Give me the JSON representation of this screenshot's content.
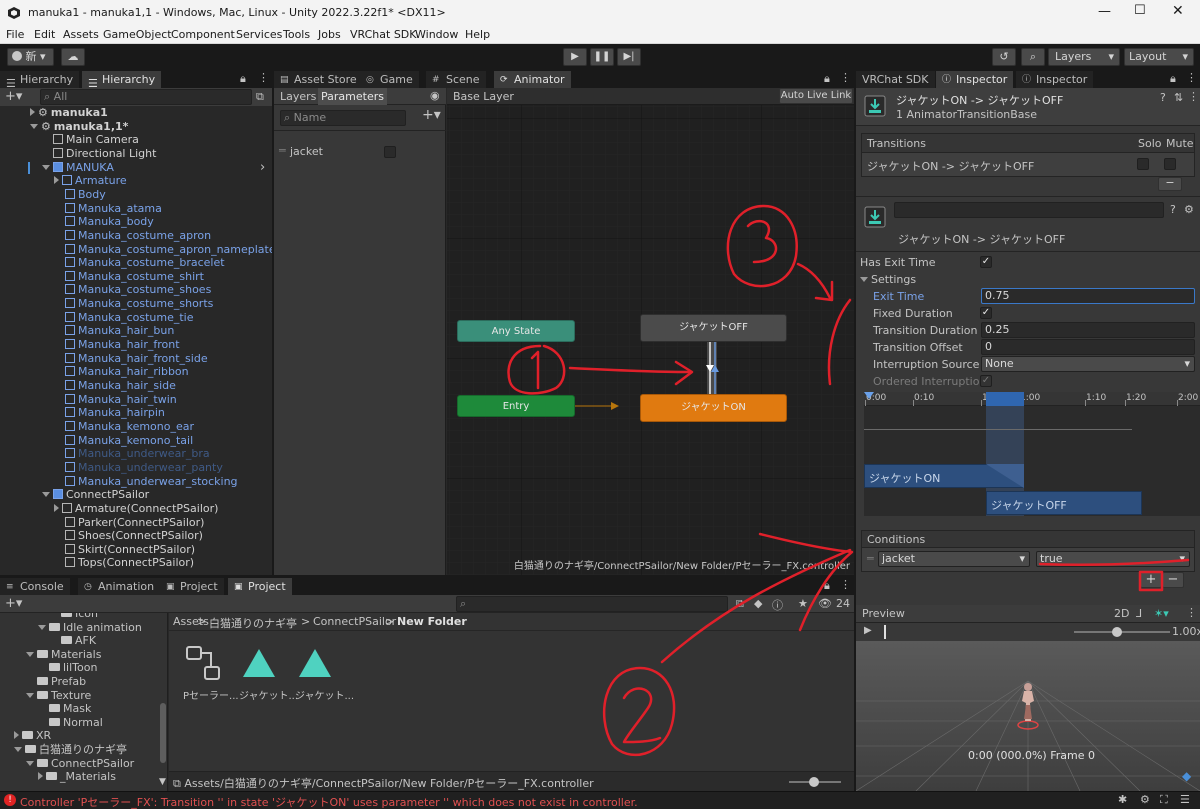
{
  "window": {
    "title": "manuka1 - manuka1,1 - Windows, Mac, Linux - Unity 2022.3.22f1* <DX11>"
  },
  "menu": [
    "File",
    "Edit",
    "Assets",
    "GameObject",
    "Component",
    "Services",
    "Tools",
    "Jobs",
    "VRChat SDK",
    "Window",
    "Help"
  ],
  "toolbar": {
    "account_label": "新",
    "layers_label": "Layers",
    "layout_label": "Layout"
  },
  "hierarchy": {
    "tabs": [
      "Hierarchy",
      "Hierarchy"
    ],
    "search_placeholder": "All",
    "items": [
      {
        "label": "manuka1",
        "indent": 0,
        "kind": "scene",
        "color": "white",
        "arrow": "right"
      },
      {
        "label": "manuka1,1*",
        "indent": 0,
        "kind": "scene",
        "color": "white",
        "arrow": "down"
      },
      {
        "label": "Main Camera",
        "indent": 1,
        "kind": "cube",
        "color": "white"
      },
      {
        "label": "Directional Light",
        "indent": 1,
        "kind": "cube",
        "color": "white"
      },
      {
        "label": "MANUKA",
        "indent": 1,
        "kind": "prefab",
        "color": "blue",
        "arrow": "down"
      },
      {
        "label": "Armature",
        "indent": 2,
        "kind": "cube",
        "color": "blue",
        "arrow": "right"
      },
      {
        "label": "Body",
        "indent": 2,
        "kind": "cube",
        "color": "blue"
      },
      {
        "label": "Manuka_atama",
        "indent": 2,
        "kind": "cube",
        "color": "blue"
      },
      {
        "label": "Manuka_body",
        "indent": 2,
        "kind": "cube",
        "color": "blue"
      },
      {
        "label": "Manuka_costume_apron",
        "indent": 2,
        "kind": "cube",
        "color": "blue"
      },
      {
        "label": "Manuka_costume_apron_nameplate",
        "indent": 2,
        "kind": "cube",
        "color": "blue"
      },
      {
        "label": "Manuka_costume_bracelet",
        "indent": 2,
        "kind": "cube",
        "color": "blue"
      },
      {
        "label": "Manuka_costume_shirt",
        "indent": 2,
        "kind": "cube",
        "color": "blue"
      },
      {
        "label": "Manuka_costume_shoes",
        "indent": 2,
        "kind": "cube",
        "color": "blue"
      },
      {
        "label": "Manuka_costume_shorts",
        "indent": 2,
        "kind": "cube",
        "color": "blue"
      },
      {
        "label": "Manuka_costume_tie",
        "indent": 2,
        "kind": "cube",
        "color": "blue"
      },
      {
        "label": "Manuka_hair_bun",
        "indent": 2,
        "kind": "cube",
        "color": "blue"
      },
      {
        "label": "Manuka_hair_front",
        "indent": 2,
        "kind": "cube",
        "color": "blue"
      },
      {
        "label": "Manuka_hair_front_side",
        "indent": 2,
        "kind": "cube",
        "color": "blue"
      },
      {
        "label": "Manuka_hair_ribbon",
        "indent": 2,
        "kind": "cube",
        "color": "blue"
      },
      {
        "label": "Manuka_hair_side",
        "indent": 2,
        "kind": "cube",
        "color": "blue"
      },
      {
        "label": "Manuka_hair_twin",
        "indent": 2,
        "kind": "cube",
        "color": "blue"
      },
      {
        "label": "Manuka_hairpin",
        "indent": 2,
        "kind": "cube",
        "color": "blue"
      },
      {
        "label": "Manuka_kemono_ear",
        "indent": 2,
        "kind": "cube",
        "color": "blue"
      },
      {
        "label": "Manuka_kemono_tail",
        "indent": 2,
        "kind": "cube",
        "color": "blue"
      },
      {
        "label": "Manuka_underwear_bra",
        "indent": 2,
        "kind": "cube",
        "color": "dim"
      },
      {
        "label": "Manuka_underwear_panty",
        "indent": 2,
        "kind": "cube",
        "color": "dim"
      },
      {
        "label": "Manuka_underwear_stocking",
        "indent": 2,
        "kind": "cube",
        "color": "blue"
      },
      {
        "label": "ConnectPSailor",
        "indent": 1,
        "kind": "prefab",
        "color": "white",
        "arrow": "down"
      },
      {
        "label": "Armature(ConnectPSailor)",
        "indent": 2,
        "kind": "cube",
        "color": "white",
        "arrow": "right"
      },
      {
        "label": "Parker(ConnectPSailor)",
        "indent": 2,
        "kind": "cube",
        "color": "white"
      },
      {
        "label": "Shoes(ConnectPSailor)",
        "indent": 2,
        "kind": "cube",
        "color": "white"
      },
      {
        "label": "Skirt(ConnectPSailor)",
        "indent": 2,
        "kind": "cube",
        "color": "white"
      },
      {
        "label": "Tops(ConnectPSailor)",
        "indent": 2,
        "kind": "cube",
        "color": "white"
      }
    ]
  },
  "center_tabs": [
    "Asset Store",
    "Game",
    "Scene",
    "Animator"
  ],
  "animator": {
    "subtabs": [
      "Layers",
      "Parameters"
    ],
    "name_placeholder": "Name",
    "parameter": "jacket",
    "breadcrumb": "Base Layer",
    "auto_live_link": "Auto Live Link",
    "nodes": {
      "any_state": "Any State",
      "entry": "Entry",
      "off": "ジャケットOFF",
      "on": "ジャケットON"
    },
    "footer_path": "白猫通りのナギ亭/ConnectPSailor/New Folder/Pセーラー_FX.controller"
  },
  "annotations": {
    "one": "①",
    "two": "②",
    "three": "③"
  },
  "inspector": {
    "tabs": [
      "VRChat SDK",
      "Inspector",
      "Inspector"
    ],
    "header_title": "ジャケットON -> ジャケットOFF",
    "header_sub": "1 AnimatorTransitionBase",
    "transitions_label": "Transitions",
    "solo_label": "Solo",
    "mute_label": "Mute",
    "transition_row": "ジャケットON -> ジャケットOFF",
    "transition_name": "ジャケットON -> ジャケットOFF",
    "has_exit_time": "Has Exit Time",
    "settings": "Settings",
    "exit_time_label": "Exit Time",
    "exit_time": "0.75",
    "fixed_duration": "Fixed Duration",
    "transition_duration_label": "Transition Duration (s)",
    "transition_duration": "0.25",
    "transition_offset_label": "Transition Offset",
    "transition_offset": "0",
    "interruption_source_label": "Interruption Source",
    "interruption_source": "None",
    "ordered_interruption": "Ordered Interruption",
    "timeline_ticks": [
      "0:00",
      "0:10",
      "1:0",
      "1:00",
      "1:10",
      "1:20",
      "2:00"
    ],
    "timeline_on": "ジャケットON",
    "timeline_off": "ジャケットOFF",
    "conditions_label": "Conditions",
    "condition_param": "jacket",
    "condition_value": "true",
    "preview_label": "Preview",
    "preview_2d": "2D",
    "preview_speed": "1.00x",
    "preview_time": "0:00 (000.0%) Frame 0"
  },
  "bottom_tabs": [
    "Console",
    "Animation",
    "Project",
    "Project"
  ],
  "project": {
    "tree": [
      {
        "label": "Icon",
        "indent": 3
      },
      {
        "label": "Idle animation",
        "indent": 2,
        "arrow": "down"
      },
      {
        "label": "AFK",
        "indent": 3
      },
      {
        "label": "Materials",
        "indent": 1,
        "arrow": "down"
      },
      {
        "label": "lilToon",
        "indent": 2
      },
      {
        "label": "Prefab",
        "indent": 1
      },
      {
        "label": "Texture",
        "indent": 1,
        "arrow": "down"
      },
      {
        "label": "Mask",
        "indent": 2
      },
      {
        "label": "Normal",
        "indent": 2
      },
      {
        "label": "XR",
        "indent": 0,
        "arrow": "right"
      },
      {
        "label": "白猫通りのナギ亭",
        "indent": 0,
        "arrow": "down"
      },
      {
        "label": "ConnectPSailor",
        "indent": 1,
        "arrow": "down"
      },
      {
        "label": "_Materials",
        "indent": 2,
        "arrow": "right"
      }
    ],
    "breadcrumb": [
      "Assets",
      "白猫通りのナギ亭",
      "ConnectPSailor",
      "New Folder"
    ],
    "assets": [
      "Pセーラー...",
      "ジャケット...",
      "ジャケット..."
    ],
    "footer_path": "Assets/白猫通りのナギ亭/ConnectPSailor/New Folder/Pセーラー_FX.controller",
    "count": "24"
  },
  "status": {
    "message": "Controller 'Pセーラー_FX': Transition '' in state 'ジャケットON' uses parameter '' which does not exist in controller."
  },
  "colors": {
    "annotation_red": "#e0202a",
    "selected_blue": "#2c5d87",
    "on_node": "#e07a10",
    "entry_node": "#1e8a3a",
    "any_state_node": "#3a8f7a"
  }
}
